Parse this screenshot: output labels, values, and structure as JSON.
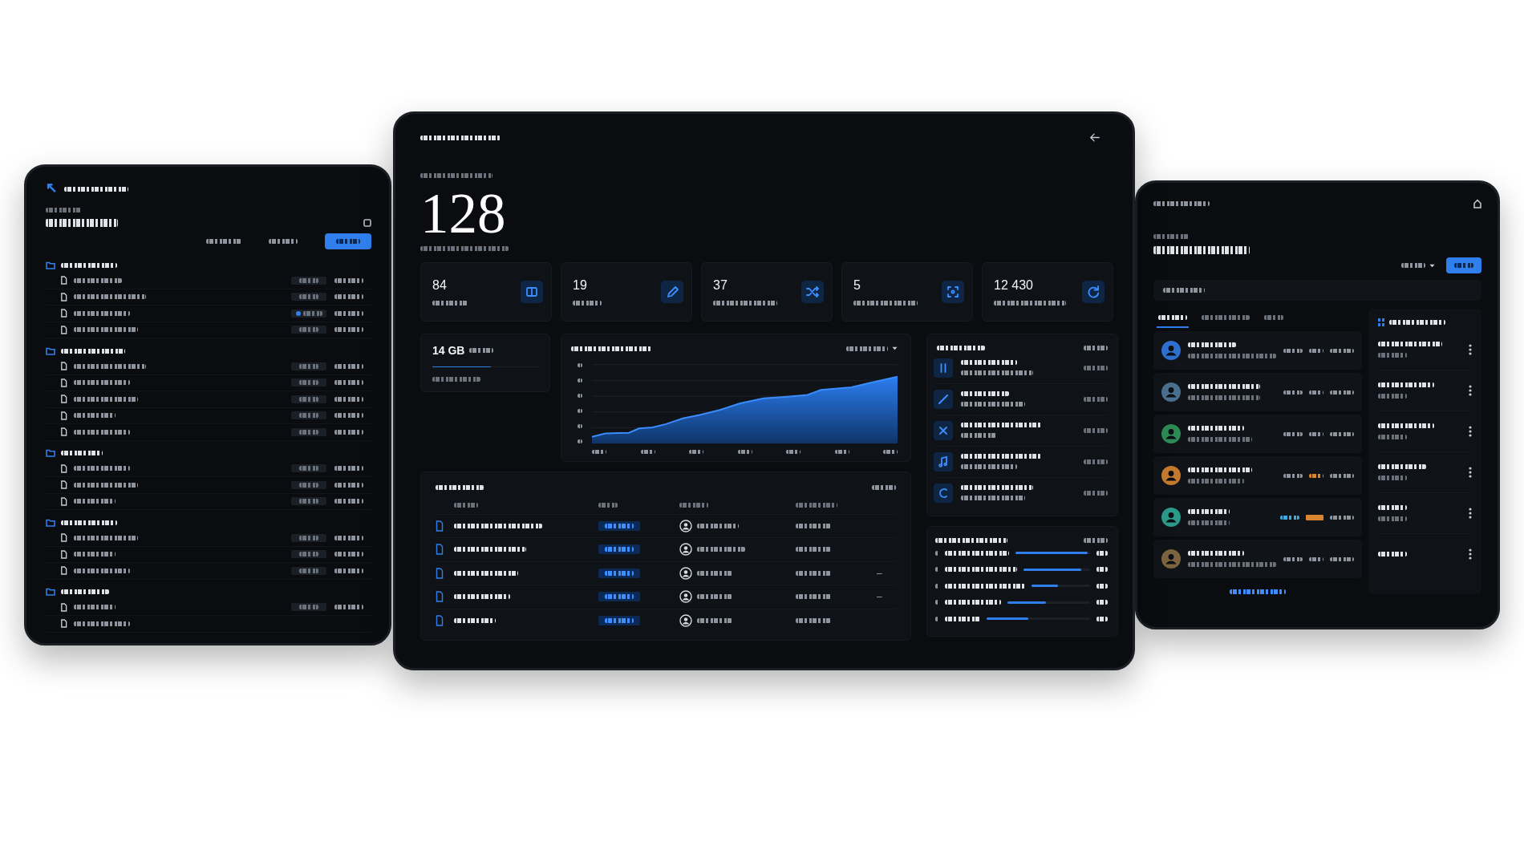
{
  "dashboard": {
    "total": "128",
    "stats": [
      {
        "value": "84"
      },
      {
        "value": "19"
      },
      {
        "value": "37"
      },
      {
        "value": "5"
      },
      {
        "value": "12 430"
      }
    ],
    "storage": {
      "value": "14 GB",
      "level": 0.55
    },
    "table": {
      "rows": [
        {},
        {},
        {
          "column_5": "–"
        },
        {
          "column_5": "–"
        },
        {}
      ]
    },
    "progress": [
      {
        "level": 0.97
      },
      {
        "level": 0.87
      },
      {
        "level": 0.45
      },
      {
        "level": 0.47
      },
      {
        "level": 0.4
      }
    ]
  },
  "left_window": {
    "tree": [
      {
        "children": [
          {
            "badge": true,
            "flagged": false
          },
          {
            "badge": true,
            "flagged": false
          },
          {
            "badge": true,
            "flagged": true
          },
          {
            "badge": true,
            "flagged": false
          }
        ]
      },
      {
        "children": [
          {
            "badge": true,
            "flagged": false
          },
          {
            "badge": true,
            "flagged": false
          },
          {
            "badge": true,
            "flagged": false
          },
          {
            "badge": true,
            "flagged": false
          },
          {
            "badge": true,
            "flagged": false
          }
        ]
      },
      {
        "children": [
          {
            "badge": true,
            "flagged": false
          },
          {
            "badge": true,
            "flagged": false
          },
          {
            "badge": true,
            "flagged": false
          }
        ]
      },
      {
        "children": [
          {
            "badge": true,
            "flagged": false
          },
          {
            "badge": true,
            "flagged": false
          },
          {
            "badge": true,
            "flagged": false
          }
        ]
      },
      {
        "children": [
          {
            "badge": true,
            "flagged": false
          },
          {
            "badge": false
          }
        ]
      }
    ]
  },
  "right_window": {
    "tabs": [
      {
        "selected": true
      },
      {
        "selected": false
      },
      {
        "selected": false
      }
    ],
    "contacts": [
      {
        "color": "#2f6fd0",
        "tags": [
          {
            "kind": "text",
            "color": "#8e959f"
          },
          {
            "kind": "text",
            "color": "#8e959f"
          },
          {
            "kind": "text",
            "color": "#8e959f"
          }
        ]
      },
      {
        "color": "#4a6f8f",
        "tags": [
          {
            "kind": "text",
            "color": "#8e959f"
          },
          {
            "kind": "text",
            "color": "#8e959f"
          },
          {
            "kind": "text",
            "color": "#8e959f"
          }
        ]
      },
      {
        "color": "#2e8a55",
        "tags": [
          {
            "kind": "text",
            "color": "#8e959f"
          },
          {
            "kind": "text",
            "color": "#8e959f"
          },
          {
            "kind": "text",
            "color": "#8e959f"
          }
        ]
      },
      {
        "color": "#c47a2e",
        "tags": [
          {
            "kind": "text",
            "color": "#8e959f"
          },
          {
            "kind": "text",
            "color": "#d9862f"
          },
          {
            "kind": "text",
            "color": "#8e959f"
          }
        ]
      },
      {
        "color": "#2a9a8a",
        "tags": [
          {
            "kind": "text",
            "color": "#3fa9d8"
          },
          {
            "kind": "badge",
            "color": "#d9862f"
          },
          {
            "kind": "text",
            "color": "#8e959f"
          }
        ]
      },
      {
        "color": "#7d6440",
        "tags": [
          {
            "kind": "text",
            "color": "#8e959f"
          },
          {
            "kind": "text",
            "color": "#8e959f"
          },
          {
            "kind": "text",
            "color": "#8e959f"
          }
        ]
      }
    ]
  }
}
